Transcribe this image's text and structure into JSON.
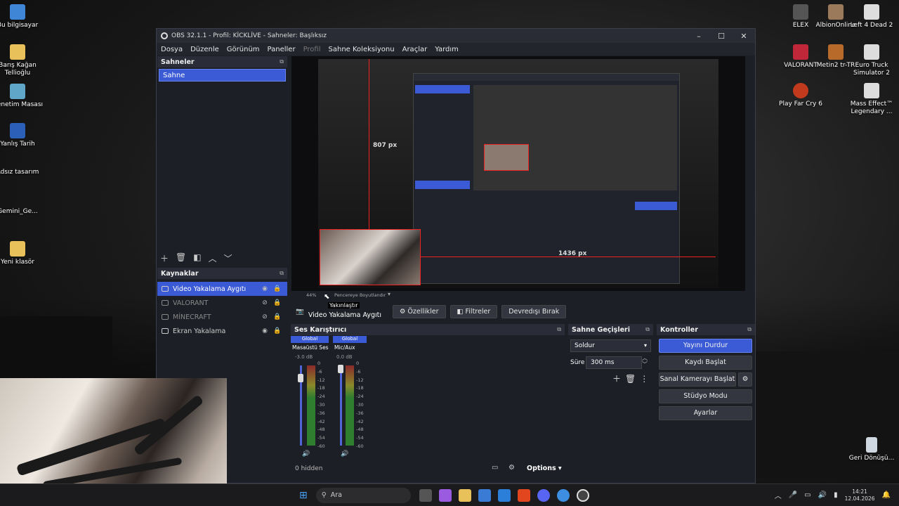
{
  "desktop": {
    "left_icons": [
      "Bu bilgisayar",
      "Barış Kağan Tellioğlu",
      "Denetim Masası",
      "Yanlış Tarih",
      "Adsız tasarım",
      "Gemini_Ge...",
      "Yeni klasör"
    ],
    "right_icons": [
      "ELEX",
      "AlbionOnline",
      "Left 4 Dead 2",
      "VALORANT",
      "Metin2 tr-TR",
      "Euro Truck Simulator 2",
      "Play Far Cry 6",
      "Mass Effect™ Legendary ..."
    ],
    "recycle": "Geri Dönüşü..."
  },
  "window": {
    "title": "OBS 32.1.1 - Profil: KİCKLİVE - Sahneler: Başlıksız",
    "menu": [
      "Dosya",
      "Düzenle",
      "Görünüm",
      "Paneller",
      "Profil",
      "Sahne Koleksiyonu",
      "Araçlar",
      "Yardım"
    ],
    "controls": [
      "–",
      "☐",
      "✕"
    ]
  },
  "scenes": {
    "title": "Sahneler",
    "items": [
      "Sahne"
    ]
  },
  "sources": {
    "title": "Kaynaklar",
    "items": [
      {
        "name": "Video Yakalama Aygıtı",
        "visible": true
      },
      {
        "name": "VALORANT",
        "visible": false
      },
      {
        "name": "MİNECRAFT",
        "visible": false
      },
      {
        "name": "Ekran Yakalama",
        "visible": true
      }
    ]
  },
  "preview": {
    "height_label": "807 px",
    "width_label": "1436 px",
    "zoom": "44%",
    "zoom_mode": "Pencereye Boyutlandır",
    "tooltip": "Yakınlaştır"
  },
  "context_bar": {
    "source": "Video Yakalama Aygıtı",
    "properties": "Özellikler",
    "filters": "Filtreler",
    "deactivate": "Devredışı Bırak"
  },
  "mixer": {
    "title": "Ses Karıştırıcı",
    "channels": [
      {
        "tag": "Global",
        "name": "Masaüstü Ses",
        "db": "-3.0 dB"
      },
      {
        "tag": "Global",
        "name": "Mic/Aux",
        "db": "0.0 dB"
      }
    ],
    "scale": [
      "0",
      "-6",
      "-12",
      "-18",
      "-24",
      "-30",
      "-36",
      "-42",
      "-48",
      "-54",
      "-60"
    ],
    "hidden": "0 hidden",
    "options": "Options"
  },
  "transitions": {
    "title": "Sahne Geçişleri",
    "type": "Soldur",
    "duration_label": "Süre",
    "duration": "300 ms"
  },
  "controls": {
    "title": "Kontroller",
    "buttons": [
      "Yayını Durdur",
      "Kaydı Başlat",
      "Sanal Kamerayı Başlat",
      "Stüdyo Modu",
      "Ayarlar"
    ]
  },
  "taskbar": {
    "search": "Ara",
    "time": "14:21",
    "date": "12.04.2026"
  },
  "colors": {
    "accent": "#3b5bd6",
    "panel": "#1d1f26",
    "red_guide": "#e22222"
  }
}
